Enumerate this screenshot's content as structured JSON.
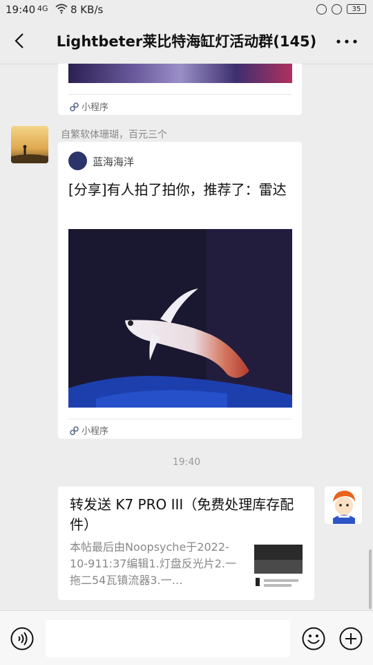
{
  "status_bar": {
    "time": "19:40",
    "signal": "4G",
    "speed": "8 KB/s",
    "battery": "35"
  },
  "header": {
    "title": "Lightbeter莱比特海缸灯活动群(145)"
  },
  "messages": {
    "first_card": {
      "mini_program_label": "小程序"
    },
    "second": {
      "sender": "自繁软体珊瑚，百元三个",
      "app_name": "蓝海海洋",
      "title": "[分享]有人拍了拍你，推荐了：雷达",
      "mini_program_label": "小程序"
    },
    "timestamp": "19:40",
    "third": {
      "title": "转发送 K7 PRO III（免费处理库存配件）",
      "excerpt": "本帖最后由Noopsyche于2022-10-911:37编辑1.灯盘反光片2.一拖二54瓦镇流器3.一…"
    }
  },
  "colors": {
    "background": "#ededed",
    "card": "#ffffff",
    "link_blue": "#5b6b8c"
  }
}
